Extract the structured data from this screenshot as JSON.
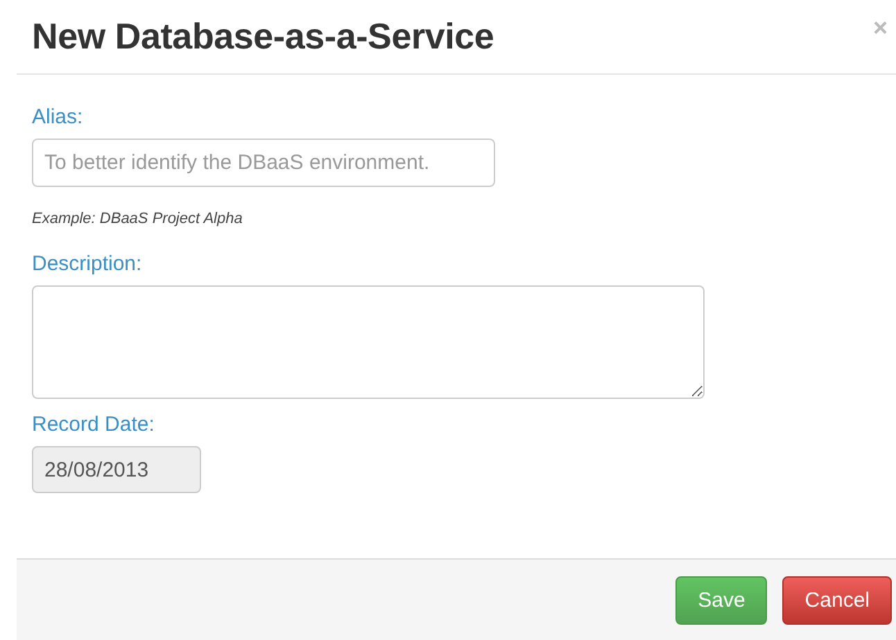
{
  "modal": {
    "title": "New Database-as-a-Service",
    "close": "×"
  },
  "fields": [
    {
      "kind": "text",
      "label": "Alias:",
      "placeholder": "To better identify the DBaaS environment.",
      "hint": "Example: DBaaS Project Alpha"
    },
    {
      "kind": "textarea",
      "label": "Description:"
    },
    {
      "kind": "date",
      "label": "Record Date:",
      "value": "28/08/2013",
      "disabled": true
    }
  ],
  "buttons": [
    {
      "kind": "success",
      "label": "Save"
    },
    {
      "kind": "danger",
      "label": "Cancel"
    }
  ]
}
